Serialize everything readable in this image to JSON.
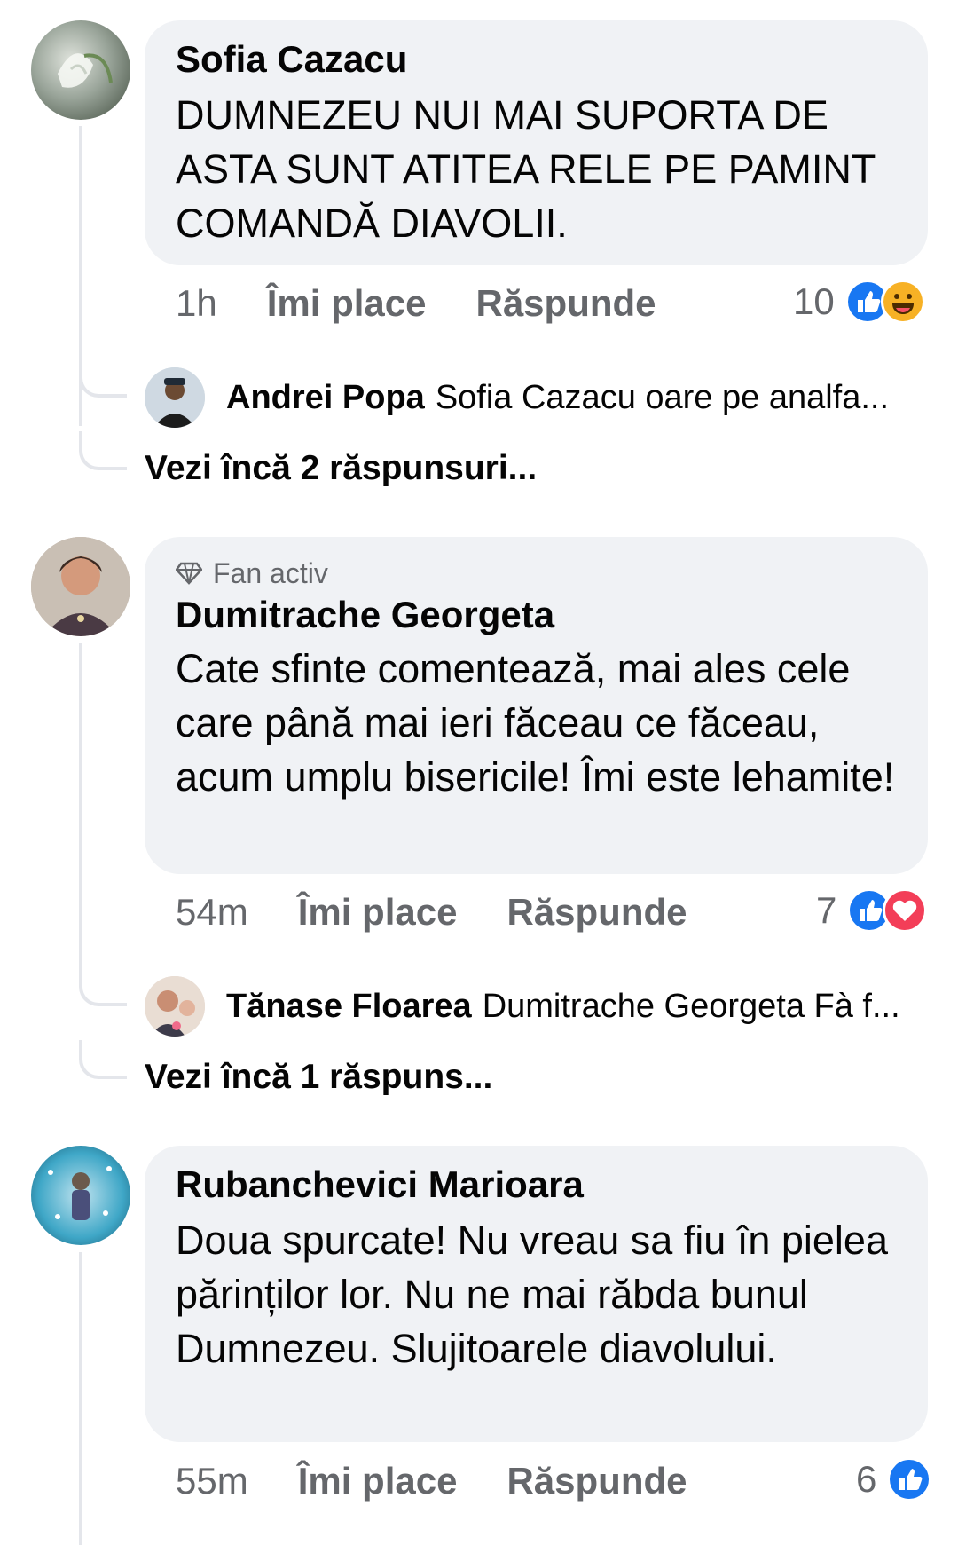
{
  "comments": [
    {
      "author": "Sofia Cazacu",
      "badge": "",
      "text": "DUMNEZEU NUI MAI SUPORTA DE ASTA SUNT ATITEA RELE PE PAMINT COMANDĂ DIAVOLII.",
      "time": "1h",
      "like_label": "Îmi place",
      "reply_label": "Răspunde",
      "reaction_count": "10",
      "reactions": [
        "like",
        "haha"
      ],
      "reply_preview": {
        "author": "Andrei Popa",
        "text": "Sofia Cazacu oare pe analfa..."
      },
      "more_replies": "Vezi încă 2 răspunsuri..."
    },
    {
      "author": "Dumitrache Georgeta",
      "badge": "Fan activ",
      "text": "Cate sfinte comentează, mai ales cele care până mai ieri făceau ce făceau, acum umplu bisericile! Îmi este lehamite!",
      "time": "54m",
      "like_label": "Îmi place",
      "reply_label": "Răspunde",
      "reaction_count": "7",
      "reactions": [
        "like",
        "love"
      ],
      "reply_preview": {
        "author": "Tănase Floarea",
        "text": "Dumitrache Georgeta Fà f..."
      },
      "more_replies": "Vezi încă 1 răspuns..."
    },
    {
      "author": "Rubanchevici Marioara",
      "badge": "",
      "text": "Doua spurcate! Nu vreau sa fiu în pielea părinților lor. Nu ne mai răbda bunul Dumnezeu. Slujitoarele diavolului.",
      "time": "55m",
      "like_label": "Îmi place",
      "reply_label": "Răspunde",
      "reaction_count": "6",
      "reactions": [
        "like"
      ]
    }
  ],
  "colors": {
    "bubble": "#f0f2f5",
    "secondary_text": "#65676b",
    "like": "#1877f2",
    "love": "#f33e58",
    "haha": "#f7b125"
  }
}
